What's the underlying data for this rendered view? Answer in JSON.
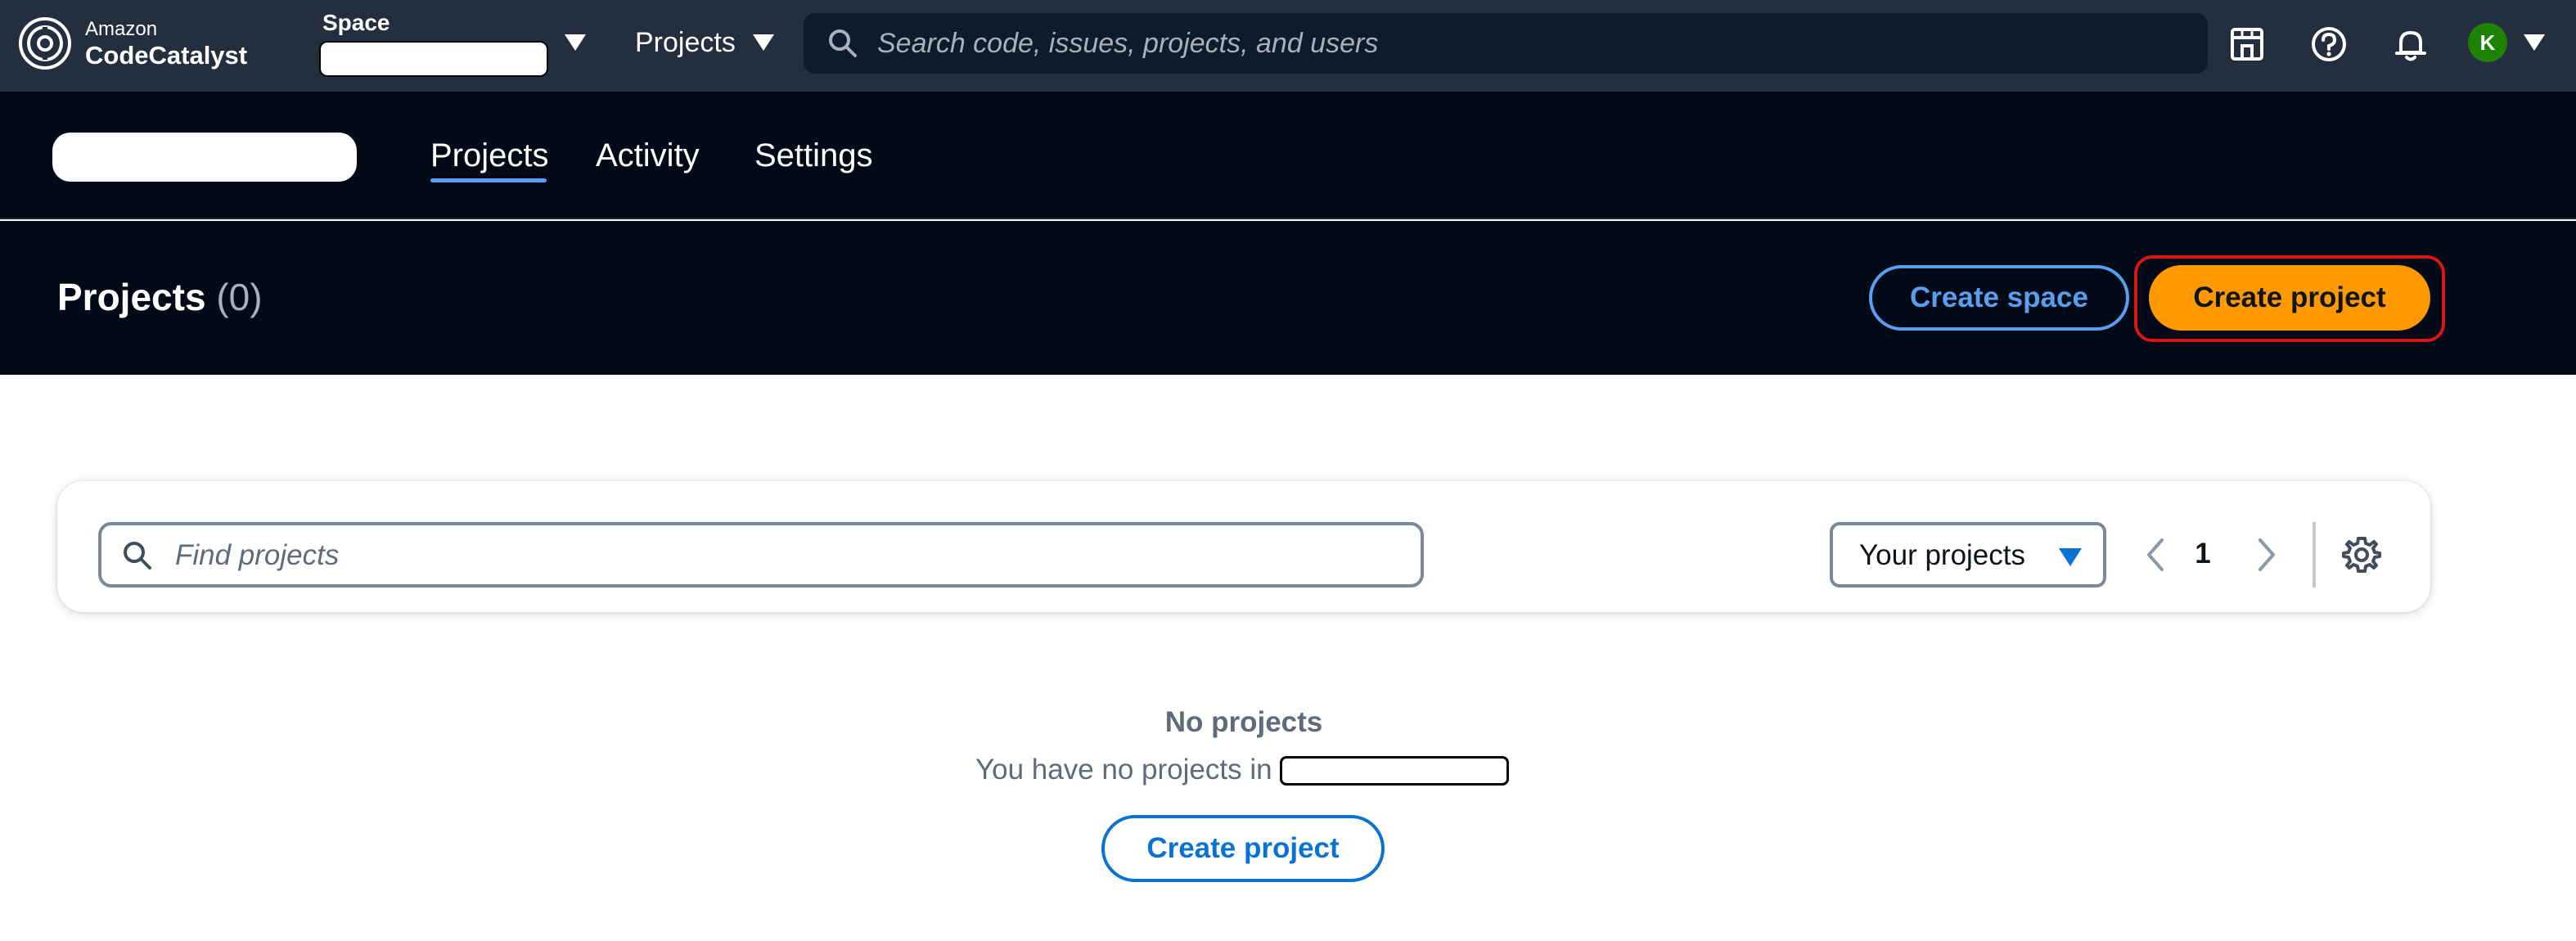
{
  "topbar": {
    "brand_small": "Amazon",
    "brand_big": "CodeCatalyst",
    "space_label": "Space",
    "space_value": "",
    "projects_label": "Projects",
    "search_placeholder": "Search code, issues, projects, and users",
    "avatar_initial": "K",
    "icons": [
      "codecatalyst-logo-icon",
      "chevron-down-icon",
      "search-icon",
      "store-icon",
      "help-icon",
      "bell-icon",
      "avatar"
    ]
  },
  "subnav": {
    "space_name": "",
    "tabs": [
      {
        "label": "Projects",
        "active": true
      },
      {
        "label": "Activity",
        "active": false
      },
      {
        "label": "Settings",
        "active": false
      }
    ]
  },
  "header": {
    "title": "Projects",
    "count": "(0)",
    "create_space_label": "Create space",
    "create_project_label": "Create project"
  },
  "filter": {
    "find_placeholder": "Find projects",
    "scope_value": "Your projects",
    "page_number": "1"
  },
  "empty_state": {
    "title": "No projects",
    "text": "You have no projects in",
    "space_name": "",
    "button_label": "Create project"
  },
  "colors": {
    "topbar_bg": "#232f3e",
    "nav_bg": "#020a18",
    "primary_orange": "#ff9900",
    "link_blue": "#0972d3",
    "highlight_red": "#d91515",
    "avatar_green": "#1d8102"
  }
}
